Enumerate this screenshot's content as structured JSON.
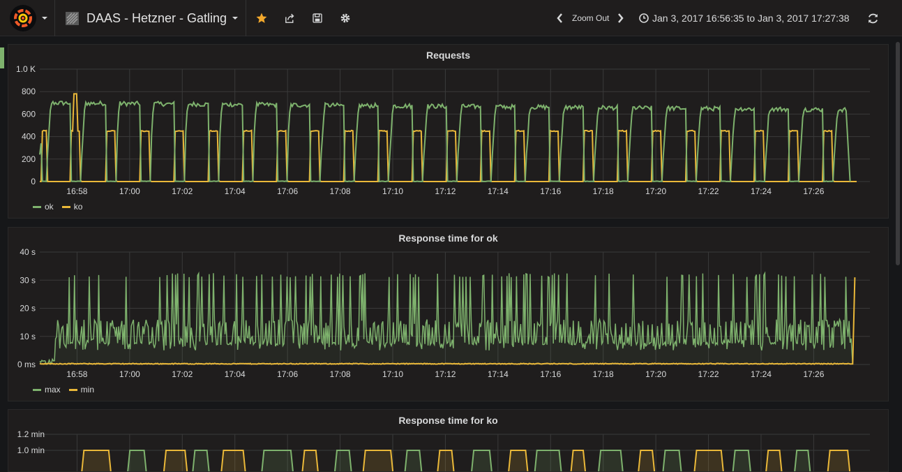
{
  "navbar": {
    "dashboard_title": "DAAS - Hetzner - Gatling",
    "zoom_label": "Zoom Out",
    "time_range": "Jan 3, 2017 16:56:35 to Jan 3, 2017 17:27:38",
    "icons": [
      "grafana-logo-icon",
      "grid-icon",
      "star-icon",
      "share-icon",
      "save-icon",
      "gear-icon",
      "chevron-left-icon",
      "chevron-right-icon",
      "clock-icon",
      "refresh-icon"
    ],
    "star_color": "#f2a82c"
  },
  "panels": {
    "requests": {
      "title": "Requests"
    },
    "rt_ok": {
      "title": "Response time for ok"
    },
    "rt_ko": {
      "title": "Response time for ko"
    }
  },
  "colors": {
    "green": "#7eb26d",
    "yellow": "#eab839"
  },
  "chart_data": [
    {
      "type": "line",
      "title": "Requests",
      "x_tick_labels": [
        "16:58",
        "17:00",
        "17:02",
        "17:04",
        "17:06",
        "17:08",
        "17:10",
        "17:12",
        "17:14",
        "17:16",
        "17:18",
        "17:20",
        "17:22",
        "17:24",
        "17:26"
      ],
      "y_tick_labels": [
        "1.0 K",
        "800",
        "600",
        "400",
        "200",
        "0"
      ],
      "ylim": [
        0,
        1000
      ],
      "xlim": [
        "16:56:35",
        "17:27:38"
      ],
      "grid": true,
      "legend_placement": "bottom-left",
      "series": [
        {
          "name": "ok",
          "color": "#7eb26d",
          "pattern": "square wave: ~700 for ~1 min, ~0 for ~0.5 min, repeated; decays to ~650 by end"
        },
        {
          "name": "ko",
          "color": "#eab839",
          "pattern": "~450 during the gaps between ok bursts, ~0 otherwise; spikes to ~780 near 16:57"
        }
      ]
    },
    {
      "type": "line",
      "title": "Response time for ok",
      "x_tick_labels": [
        "16:58",
        "17:00",
        "17:02",
        "17:04",
        "17:06",
        "17:08",
        "17:10",
        "17:12",
        "17:14",
        "17:16",
        "17:18",
        "17:20",
        "17:22",
        "17:24",
        "17:26"
      ],
      "y_tick_labels": [
        "40 s",
        "30 s",
        "20 s",
        "10 s",
        "0 ms"
      ],
      "ylim": [
        0,
        40
      ],
      "unit": "s",
      "grid": true,
      "legend_placement": "bottom-left",
      "series": [
        {
          "name": "max",
          "color": "#7eb26d",
          "pattern": "noisy, mostly 5–15 s with frequent spikes to ~31–33 s"
        },
        {
          "name": "min",
          "color": "#eab839",
          "pattern": "~0 s throughout; spikes to ~31 s at 17:27"
        }
      ]
    },
    {
      "type": "line",
      "title": "Response time for ko",
      "y_tick_labels": [
        "1.2 min",
        "1.0 min"
      ],
      "ylim": [
        0,
        1.2
      ],
      "unit": "min",
      "grid": true,
      "series": [
        {
          "color": "#7eb26d",
          "pattern": "square pulses up to ~1.0 min"
        },
        {
          "color": "#eab839",
          "pattern": "square pulses up to ~1.0 min"
        }
      ]
    }
  ]
}
